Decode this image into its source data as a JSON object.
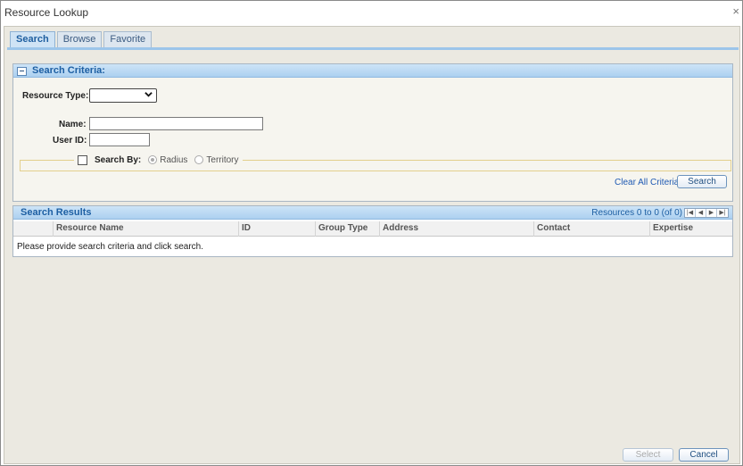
{
  "window": {
    "title": "Resource Lookup",
    "close_glyph": "×"
  },
  "tabs": [
    {
      "label": "Search",
      "active": true
    },
    {
      "label": "Browse",
      "active": false
    },
    {
      "label": "Favorite",
      "active": false
    }
  ],
  "criteria": {
    "title": "Search Criteria:",
    "collapse_glyph": "–",
    "resource_type_label": "Resource Type:",
    "resource_type_value": "",
    "name_label": "Name:",
    "name_value": "",
    "user_id_label": "User ID:",
    "user_id_value": "",
    "search_by_label": "Search By:",
    "radius_label": "Radius",
    "territory_label": "Territory",
    "clear_label": "Clear All Criteria",
    "search_button": "Search"
  },
  "results": {
    "title": "Search Results",
    "count_text": "Resources 0 to 0 (of 0)",
    "pager": [
      "|◀",
      "◀",
      "▶",
      "▶|"
    ],
    "columns": [
      "Resource Name",
      "ID",
      "Group Type",
      "Address",
      "Contact",
      "Expertise"
    ],
    "empty_message": "Please provide search criteria and click search."
  },
  "footer": {
    "select_button": "Select",
    "cancel_button": "Cancel"
  },
  "colors": {
    "accent": "#1d5fa3",
    "header_blue": "#acd0f0",
    "background": "#ebe9e1"
  }
}
